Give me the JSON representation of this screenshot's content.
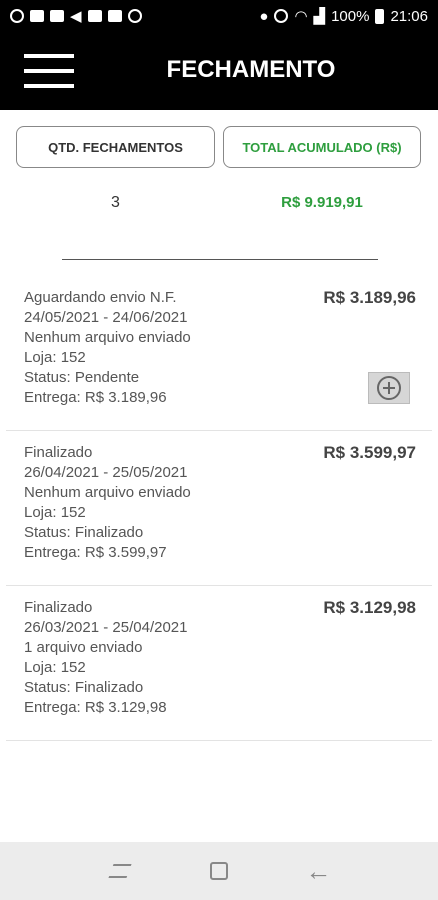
{
  "status_bar": {
    "battery": "100%",
    "time": "21:06",
    "left_icons": [
      "app-icon",
      "infinity-icon",
      "gallery-icon",
      "send-icon",
      "image-icon",
      "mail-icon",
      "whatsapp-icon"
    ],
    "right_icons": [
      "location-icon",
      "do-not-disturb-icon",
      "wifi-icon",
      "signal-icon",
      "battery-icon"
    ]
  },
  "app_bar": {
    "title": "FECHAMENTO",
    "menu_icon": "hamburger-menu-icon"
  },
  "summary": {
    "qtd_label": "QTD. FECHAMENTOS",
    "total_label": "TOTAL ACUMULADO (R$)",
    "qtd_value": "3",
    "total_value": "R$ 9.919,91",
    "accent_color": "#2e9e3e"
  },
  "items": [
    {
      "line1": "Aguardando envio N.F.",
      "line2": "24/05/2021 - 24/06/2021",
      "line3": "Nenhum arquivo enviado",
      "line4": "Loja: 152",
      "line5": "Status: Pendente",
      "line6": "Entrega: R$ 3.189,96",
      "amount": "R$ 3.189,96",
      "has_add_button": true
    },
    {
      "line1": "Finalizado",
      "line2": "26/04/2021 - 25/05/2021",
      "line3": "Nenhum arquivo enviado",
      "line4": "Loja: 152",
      "line5": "Status: Finalizado",
      "line6": "Entrega: R$ 3.599,97",
      "amount": "R$ 3.599,97",
      "has_add_button": false
    },
    {
      "line1": "Finalizado",
      "line2": "26/03/2021 - 25/04/2021",
      "line3": "1 arquivo enviado",
      "line4": "Loja: 152",
      "line5": "Status: Finalizado",
      "line6": "Entrega: R$ 3.129,98",
      "amount": "R$ 3.129,98",
      "has_add_button": false
    }
  ],
  "nav_bar": {
    "icons": [
      "recent-apps-icon",
      "home-icon",
      "back-icon"
    ]
  }
}
